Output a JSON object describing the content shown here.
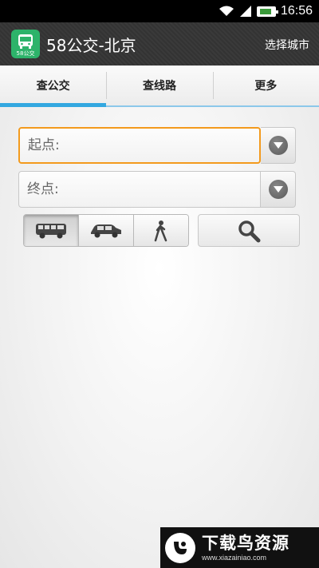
{
  "status_bar": {
    "time": "16:56",
    "icons": [
      "wifi-icon",
      "signal-icon",
      "battery-icon"
    ]
  },
  "app_bar": {
    "logo_text": "58公交",
    "title": "58公交-北京",
    "city_button": "选择城市"
  },
  "tabs": [
    {
      "label": "查公交",
      "active": true
    },
    {
      "label": "查线路",
      "active": false
    },
    {
      "label": "更多",
      "active": false
    }
  ],
  "route_form": {
    "start_placeholder": "起点:",
    "end_placeholder": "终点:",
    "modes": [
      "bus-icon",
      "car-icon",
      "walk-icon"
    ],
    "active_mode": "bus-icon",
    "search_icon": "search-icon"
  },
  "watermark": {
    "title": "下载鸟资源",
    "url": "www.xiazainiao.com"
  },
  "colors": {
    "focus": "#f39a1d",
    "tab_indicator": "#33a8e0",
    "app_logo": "#2db36a"
  }
}
